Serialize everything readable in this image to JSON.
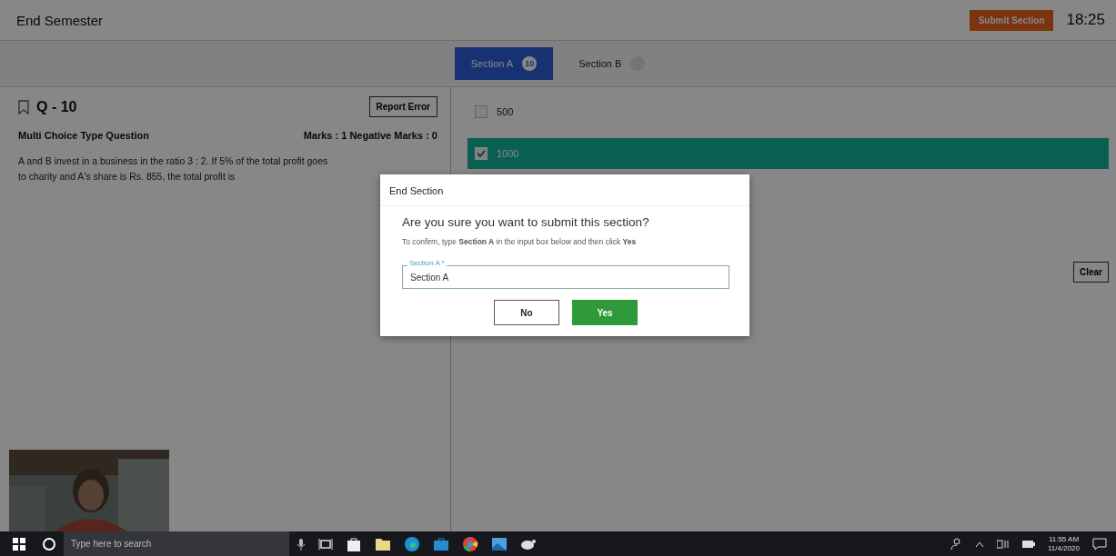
{
  "header": {
    "title": "End Semester",
    "submit_button": "Submit Section",
    "timer": "18:25"
  },
  "section_tabs": [
    {
      "label": "Section A",
      "badge": "10",
      "selected": true
    },
    {
      "label": "Section B",
      "selected": false
    }
  ],
  "question": {
    "number": "Q - 10",
    "bookmarked": false,
    "report_button": "Report Error",
    "type": "Multi Choice Type Question",
    "marks": "Marks : 1  Negative Marks : 0",
    "text": "A and B invest in a business in the ratio 3 : 2. If 5% of the total profit goes to charity and A's share is Rs. 855, the total profit is"
  },
  "options": [
    {
      "label": "500",
      "selected": false
    },
    {
      "label": "1000",
      "selected": true
    }
  ],
  "clear_button": "Clear",
  "dialog": {
    "title": "End Section",
    "question": "Are you sure you want to submit this section?",
    "instruction": "To confirm, type **Section A** in the input box below and then click **Yes**",
    "field_label": "Section A *",
    "field_value": "Section A",
    "buttons": [
      {
        "label": "No",
        "kind": "secondary"
      },
      {
        "label": "Yes",
        "kind": "primary"
      }
    ]
  },
  "taskbar": {
    "search_placeholder": "Type here to search",
    "time": "11:55 AM",
    "date": "11/4/2020"
  }
}
